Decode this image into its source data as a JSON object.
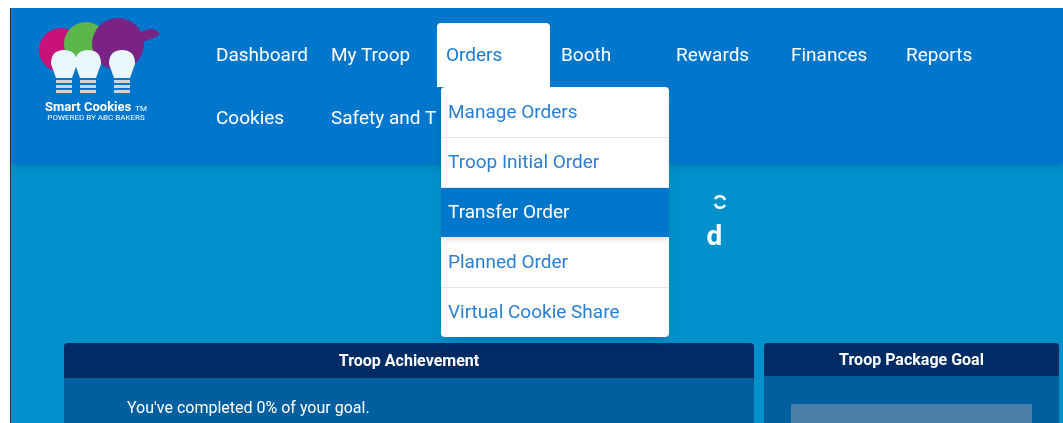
{
  "logo": {
    "name": "Smart Cookies",
    "trademark": "TM",
    "tagline": "POWERED BY ABC BAKERS"
  },
  "nav": [
    {
      "label": "Dashboard",
      "selected": false
    },
    {
      "label": "My Troop",
      "selected": false
    },
    {
      "label": "Orders",
      "selected": true
    },
    {
      "label": "Booth",
      "selected": false
    },
    {
      "label": "Rewards",
      "selected": false
    },
    {
      "label": "Finances",
      "selected": false
    },
    {
      "label": "Reports",
      "selected": false
    },
    {
      "label": "Cookies",
      "selected": false
    },
    {
      "label": "Safety and T",
      "selected": false
    }
  ],
  "dropdown": [
    {
      "label": "Manage Orders",
      "selected": false
    },
    {
      "label": "Troop Initial Order",
      "selected": false
    },
    {
      "label": "Transfer Order",
      "selected": true
    },
    {
      "label": "Planned Order",
      "selected": false
    },
    {
      "label": "Virtual Cookie Share",
      "selected": false
    }
  ],
  "heading_fragment": "d",
  "cards": [
    {
      "title": "Troop Achievement",
      "text": "You've completed 0% of your goal."
    },
    {
      "title": "Troop Package Goal"
    }
  ]
}
